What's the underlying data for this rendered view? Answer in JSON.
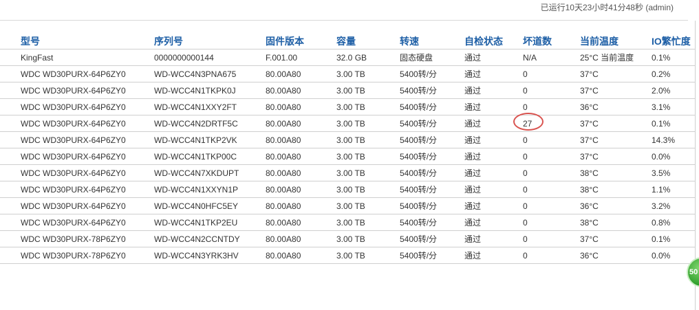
{
  "header": {
    "uptime_status": "已运行10天23小时41分48秒 (admin)"
  },
  "table": {
    "columns": [
      "型号",
      "序列号",
      "固件版本",
      "容量",
      "转速",
      "自检状态",
      "坏道数",
      "当前温度",
      "IO繁忙度"
    ],
    "rows": [
      {
        "model": "KingFast",
        "serial": "0000000000144",
        "firmware": "F.001.00",
        "capacity": "32.0 GB",
        "speed": "固态硬盘",
        "selftest": "通过",
        "bad_sectors": "N/A",
        "temperature": "25°C 当前温度",
        "io_busy": "0.1%"
      },
      {
        "model": "WDC WD30PURX-64P6ZY0",
        "serial": "WD-WCC4N3PNA675",
        "firmware": "80.00A80",
        "capacity": "3.00 TB",
        "speed": "5400转/分",
        "selftest": "通过",
        "bad_sectors": "0",
        "temperature": "37°C",
        "io_busy": "0.2%"
      },
      {
        "model": "WDC WD30PURX-64P6ZY0",
        "serial": "WD-WCC4N1TKPK0J",
        "firmware": "80.00A80",
        "capacity": "3.00 TB",
        "speed": "5400转/分",
        "selftest": "通过",
        "bad_sectors": "0",
        "temperature": "37°C",
        "io_busy": "2.0%"
      },
      {
        "model": "WDC WD30PURX-64P6ZY0",
        "serial": "WD-WCC4N1XXY2FT",
        "firmware": "80.00A80",
        "capacity": "3.00 TB",
        "speed": "5400转/分",
        "selftest": "通过",
        "bad_sectors": "0",
        "temperature": "36°C",
        "io_busy": "3.1%"
      },
      {
        "model": "WDC WD30PURX-64P6ZY0",
        "serial": "WD-WCC4N2DRTF5C",
        "firmware": "80.00A80",
        "capacity": "3.00 TB",
        "speed": "5400转/分",
        "selftest": "通过",
        "bad_sectors": "27",
        "temperature": "37°C",
        "io_busy": "0.1%",
        "highlight": true
      },
      {
        "model": "WDC WD30PURX-64P6ZY0",
        "serial": "WD-WCC4N1TKP2VK",
        "firmware": "80.00A80",
        "capacity": "3.00 TB",
        "speed": "5400转/分",
        "selftest": "通过",
        "bad_sectors": "0",
        "temperature": "37°C",
        "io_busy": "14.3%"
      },
      {
        "model": "WDC WD30PURX-64P6ZY0",
        "serial": "WD-WCC4N1TKP00C",
        "firmware": "80.00A80",
        "capacity": "3.00 TB",
        "speed": "5400转/分",
        "selftest": "通过",
        "bad_sectors": "0",
        "temperature": "37°C",
        "io_busy": "0.0%"
      },
      {
        "model": "WDC WD30PURX-64P6ZY0",
        "serial": "WD-WCC4N7XKDUPT",
        "firmware": "80.00A80",
        "capacity": "3.00 TB",
        "speed": "5400转/分",
        "selftest": "通过",
        "bad_sectors": "0",
        "temperature": "38°C",
        "io_busy": "3.5%"
      },
      {
        "model": "WDC WD30PURX-64P6ZY0",
        "serial": "WD-WCC4N1XXYN1P",
        "firmware": "80.00A80",
        "capacity": "3.00 TB",
        "speed": "5400转/分",
        "selftest": "通过",
        "bad_sectors": "0",
        "temperature": "38°C",
        "io_busy": "1.1%"
      },
      {
        "model": "WDC WD30PURX-64P6ZY0",
        "serial": "WD-WCC4N0HFC5EY",
        "firmware": "80.00A80",
        "capacity": "3.00 TB",
        "speed": "5400转/分",
        "selftest": "通过",
        "bad_sectors": "0",
        "temperature": "36°C",
        "io_busy": "3.2%"
      },
      {
        "model": "WDC WD30PURX-64P6ZY0",
        "serial": "WD-WCC4N1TKP2EU",
        "firmware": "80.00A80",
        "capacity": "3.00 TB",
        "speed": "5400转/分",
        "selftest": "通过",
        "bad_sectors": "0",
        "temperature": "38°C",
        "io_busy": "0.8%"
      },
      {
        "model": "WDC WD30PURX-78P6ZY0",
        "serial": "WD-WCC4N2CCNTDY",
        "firmware": "80.00A80",
        "capacity": "3.00 TB",
        "speed": "5400转/分",
        "selftest": "通过",
        "bad_sectors": "0",
        "temperature": "37°C",
        "io_busy": "0.1%"
      },
      {
        "model": "WDC WD30PURX-78P6ZY0",
        "serial": "WD-WCC4N3YRK3HV",
        "firmware": "80.00A80",
        "capacity": "3.00 TB",
        "speed": "5400转/分",
        "selftest": "通过",
        "bad_sectors": "0",
        "temperature": "36°C",
        "io_busy": "0.0%"
      }
    ]
  },
  "float_badge": {
    "label": "50"
  },
  "colors": {
    "header_text": "#1e5fa6",
    "io_text": "#1a3fd0",
    "highlight_ring": "#d9534f",
    "badge_green": "#2e9d2a"
  }
}
